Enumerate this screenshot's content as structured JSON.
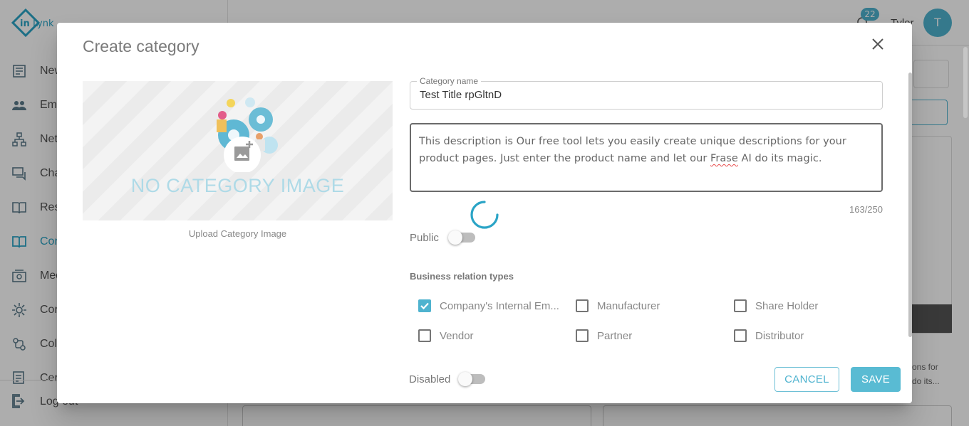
{
  "background": {
    "notification_count": "22",
    "user_name": "Tyler",
    "avatar_initial": "T",
    "sidebar": {
      "items": [
        {
          "label": "Newsfeed",
          "icon": "newspaper-icon"
        },
        {
          "label": "Employees",
          "icon": "people-icon"
        },
        {
          "label": "Network",
          "icon": "network-icon"
        },
        {
          "label": "Chat",
          "icon": "chat-icon"
        },
        {
          "label": "Resources",
          "icon": "book-icon"
        },
        {
          "label": "Content",
          "icon": "open-book-icon",
          "active": true
        },
        {
          "label": "Media",
          "icon": "media-icon"
        },
        {
          "label": "Configuration",
          "icon": "gear-icon"
        },
        {
          "label": "Collaboration",
          "icon": "collab-icon"
        },
        {
          "label": "Certificates",
          "icon": "certificate-icon"
        }
      ],
      "logout_label": "Log out"
    },
    "card_snippet": [
      "ons for",
      "do its..."
    ]
  },
  "dialog": {
    "title": "Create category",
    "image": {
      "placeholder_text": "NO CATEGORY IMAGE",
      "upload_label": "Upload Category Image"
    },
    "category_name": {
      "label": "Category name",
      "value": "Test Title rpGltnD"
    },
    "description": {
      "before": "This description is Our free tool lets you easily create unique descriptions for your product pages. Just enter the product name and let our ",
      "misspelled": "Frase",
      "after": " AI do its magic.",
      "counter": "163/250"
    },
    "public_label": "Public",
    "public_on": false,
    "business_relation": {
      "title": "Business relation types",
      "options": [
        {
          "label": "Company's Internal Em...",
          "checked": true
        },
        {
          "label": "Manufacturer",
          "checked": false
        },
        {
          "label": "Share Holder",
          "checked": false
        },
        {
          "label": "Vendor",
          "checked": false
        },
        {
          "label": "Partner",
          "checked": false
        },
        {
          "label": "Distributor",
          "checked": false
        }
      ]
    },
    "disabled_label": "Disabled",
    "disabled_on": false,
    "cancel_label": "CANCEL",
    "save_label": "SAVE"
  },
  "colors": {
    "accent": "#4fb3cf",
    "overlay": "rgba(0,0,0,0.32)"
  }
}
